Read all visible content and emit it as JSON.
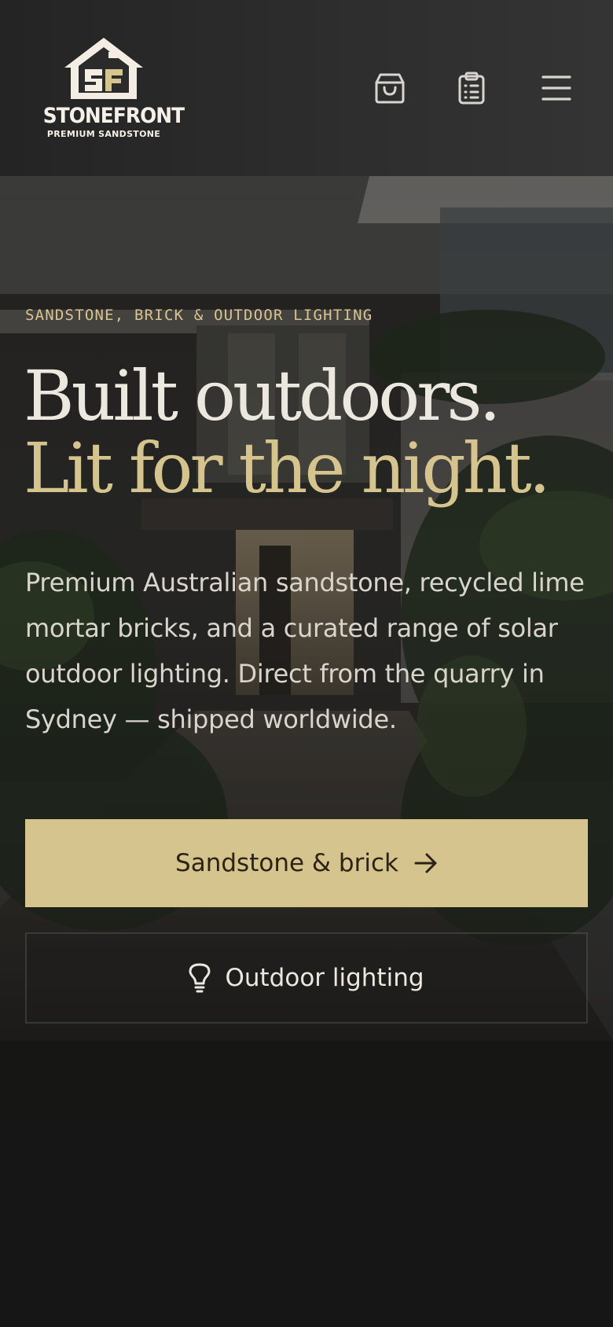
{
  "header": {
    "brand_name": "STONEFRONT",
    "brand_tagline": "PREMIUM SANDSTONE",
    "icons": {
      "cart": "shopping-bag-icon",
      "orders": "clipboard-list-icon",
      "menu": "hamburger-menu-icon"
    }
  },
  "hero": {
    "eyebrow": "SANDSTONE, BRICK & OUTDOOR LIGHTING",
    "headline_line1": "Built outdoors.",
    "headline_line2": "Lit for the night.",
    "lede": "Premium Australian sandstone, recycled lime mortar bricks, and a curated range of solar outdoor lighting. Direct from the quarry in Sydney — shipped worldwide.",
    "primary_cta": {
      "label": "Sandstone & brick",
      "icon": "arrow-right-icon"
    },
    "secondary_cta": {
      "label": "Outdoor lighting",
      "icon": "lightbulb-icon"
    }
  },
  "colors": {
    "accent": "#d5c48e",
    "header_bg": "#2b2b2b",
    "text_light": "#ece7df",
    "page_bg": "#161616"
  }
}
